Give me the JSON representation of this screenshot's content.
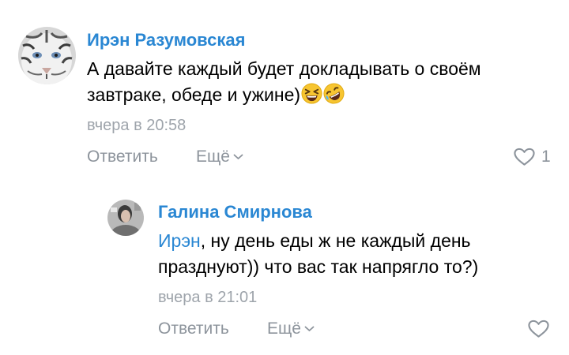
{
  "comments": [
    {
      "author": "Ирэн Разумовская",
      "text_lines": [
        "А давайте каждый будет докладывать о своём",
        "завтраке, обеде и ужине)"
      ],
      "emojis": [
        "grinning-squinting-face",
        "rolling-on-the-floor-laughing"
      ],
      "timestamp": "вчера в 20:58",
      "reply_label": "Ответить",
      "more_label": "Ещё",
      "likes": "1"
    },
    {
      "author": "Галина Смирнова",
      "mention": "Ирэн",
      "text_line1_rest": ", ну день еды ж не каждый день",
      "text_line2": "празднуют)) что вас так напрягло то?)",
      "timestamp": "вчера в 21:01",
      "reply_label": "Ответить",
      "more_label": "Ещё"
    }
  ],
  "colors": {
    "author_name": "#2a87d3",
    "mention": "#2a87d3",
    "timestamp": "#9ea4ab",
    "action_text": "#8d949c",
    "body_text": "#000000"
  }
}
